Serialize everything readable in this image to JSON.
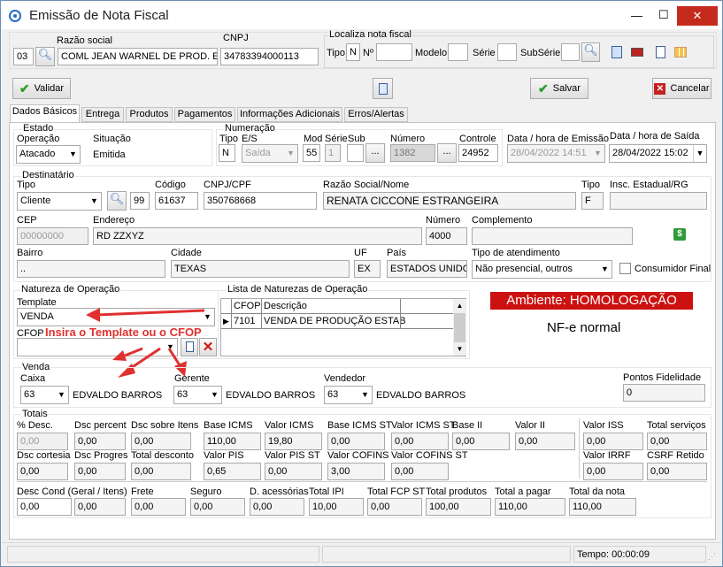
{
  "window": {
    "title": "Emissão de Nota Fiscal",
    "minimize": "—",
    "maximize": "☐",
    "close": "✕"
  },
  "header": {
    "razao_label": "Razão social",
    "cnpj_label": "CNPJ",
    "code": "03",
    "razao": "COML JEAN WARNEL DE PROD. ESP.",
    "cnpj": "34783394000113",
    "localiza": {
      "legend": "Localiza nota fiscal",
      "tipo_label": "Tipo",
      "tipo": "N",
      "n_label": "Nº",
      "modelo_label": "Modelo",
      "serie_label": "Série",
      "subserie_label": "SubSérie"
    }
  },
  "toolbar": {
    "validar": "Validar",
    "salvar": "Salvar",
    "cancelar": "Cancelar"
  },
  "tabs": [
    "Dados Básicos",
    "Entrega",
    "Produtos",
    "Pagamentos",
    "Informações Adicionais",
    "Erros/Alertas"
  ],
  "estado": {
    "legend": "Estado",
    "operacao_label": "Operação",
    "operacao": "Atacado",
    "situacao_label": "Situação",
    "situacao": "Emitida"
  },
  "numeracao": {
    "legend": "Numeração",
    "tipo_label": "Tipo",
    "tipo": "N",
    "es_label": "E/S",
    "es": "Saída",
    "mod_label": "Mod",
    "mod": "55",
    "serie_label": "Série",
    "serie": "1",
    "sub_label": "Sub",
    "numero_label": "Número",
    "numero": "1382",
    "controle_label": "Controle",
    "controle": "24952",
    "ellipsis": "..."
  },
  "datas": {
    "emissao_label": "Data / hora de Emissão",
    "emissao": "28/04/2022 14:51",
    "saida_label": "Data / hora de Saída",
    "saida": "28/04/2022 15:02"
  },
  "destinatario": {
    "legend": "Destinatário",
    "tipo_label": "Tipo",
    "tipo": "Cliente",
    "tipo_code": "99",
    "codigo_label": "Código",
    "codigo": "61637",
    "cnpj_label": "CNPJ/CPF",
    "cnpj": "350768668",
    "razao_label": "Razão Social/Nome",
    "razao": "RENATA CICCONE ESTRANGEIRA",
    "tipo2_label": "Tipo",
    "tipo2": "F",
    "ie_label": "Insc. Estadual/RG",
    "ie": "",
    "cep_label": "CEP",
    "cep": "00000000",
    "endereco_label": "Endereço",
    "endereco": "RD ZZXYZ",
    "numero_label": "Número",
    "numero": "4000",
    "complemento_label": "Complemento",
    "complemento": "",
    "money": "$",
    "bairro_label": "Bairro",
    "bairro": "..",
    "cidade_label": "Cidade",
    "cidade": "TEXAS",
    "uf_label": "UF",
    "uf": "EX",
    "pais_label": "País",
    "pais": "ESTADOS UNIDOS",
    "atendimento_label": "Tipo de atendimento",
    "atendimento": "Não presencial, outros",
    "consumidor_label": "Consumidor Final"
  },
  "natureza": {
    "legend": "Natureza de Operação",
    "template_label": "Template",
    "template": "VENDA",
    "cfop_label": "CFOP",
    "cfop": "",
    "annotation": "Insira o Template ou o CFOP"
  },
  "lista": {
    "legend": "Lista de Naturezas de Operação",
    "col_cfop": "CFOP",
    "col_desc": "Descrição",
    "rows": [
      {
        "cfop": "7101",
        "desc": "VENDA DE PRODUÇÃO ESTAB"
      }
    ]
  },
  "ambiente": {
    "banner": "Ambiente: HOMOLOGAÇÃO",
    "nfe": "NF-e normal"
  },
  "venda": {
    "legend": "Venda",
    "caixa_label": "Caixa",
    "caixa": "63",
    "caixa_name": "EDVALDO BARROS",
    "gerente_label": "Gerente",
    "gerente": "63",
    "gerente_name": "EDVALDO BARROS",
    "vendedor_label": "Vendedor",
    "vendedor": "63",
    "vendedor_name": "EDVALDO BARROS",
    "pontos_label": "Pontos Fidelidade",
    "pontos": "0"
  },
  "totais": {
    "legend": "Totais",
    "row1": [
      {
        "l": "% Desc.",
        "v": "0,00"
      },
      {
        "l": "Dsc percent",
        "v": "0,00"
      },
      {
        "l": "Dsc sobre Itens",
        "v": "0,00"
      },
      {
        "l": "Base ICMS",
        "v": "110,00"
      },
      {
        "l": "Valor ICMS",
        "v": "19,80"
      },
      {
        "l": "Base ICMS ST",
        "v": "0,00"
      },
      {
        "l": "Valor ICMS ST",
        "v": "0,00"
      },
      {
        "l": "Base II",
        "v": "0,00"
      },
      {
        "l": "Valor II",
        "v": "0,00"
      },
      {
        "l": "Valor ISS",
        "v": "0,00"
      },
      {
        "l": "Total serviços",
        "v": "0,00"
      }
    ],
    "row2": [
      {
        "l": "Dsc cortesia",
        "v": "0,00"
      },
      {
        "l": "Dsc Progres",
        "v": "0,00"
      },
      {
        "l": "Total desconto",
        "v": "0,00"
      },
      {
        "l": "Valor PIS",
        "v": "0,65"
      },
      {
        "l": "Valor PIS ST",
        "v": "0,00"
      },
      {
        "l": "Valor COFINS",
        "v": "3,00"
      },
      {
        "l": "Valor COFINS ST",
        "v": "0,00"
      },
      {
        "l": "Valor IRRF",
        "v": "0,00"
      },
      {
        "l": "CSRF Retido",
        "v": "0,00"
      }
    ],
    "row3": [
      {
        "l": "Desc Cond (Geral / Itens)",
        "v": "0,00"
      },
      {
        "l": "",
        "v": "0,00"
      },
      {
        "l": "Frete",
        "v": "0,00"
      },
      {
        "l": "Seguro",
        "v": "0,00"
      },
      {
        "l": "D. acessórias",
        "v": "0,00"
      },
      {
        "l": "Total IPI",
        "v": "10,00"
      },
      {
        "l": "Total FCP ST",
        "v": "0,00"
      },
      {
        "l": "Total produtos",
        "v": "100,00"
      },
      {
        "l": "Total a pagar",
        "v": "110,00"
      },
      {
        "l": "Total da nota",
        "v": "110,00"
      }
    ]
  },
  "status": {
    "tempo": "Tempo: 00:00:09"
  },
  "colors": {
    "accent": "#cc1111",
    "banner_bg": "#cc1111",
    "arrow": "#e03030"
  }
}
